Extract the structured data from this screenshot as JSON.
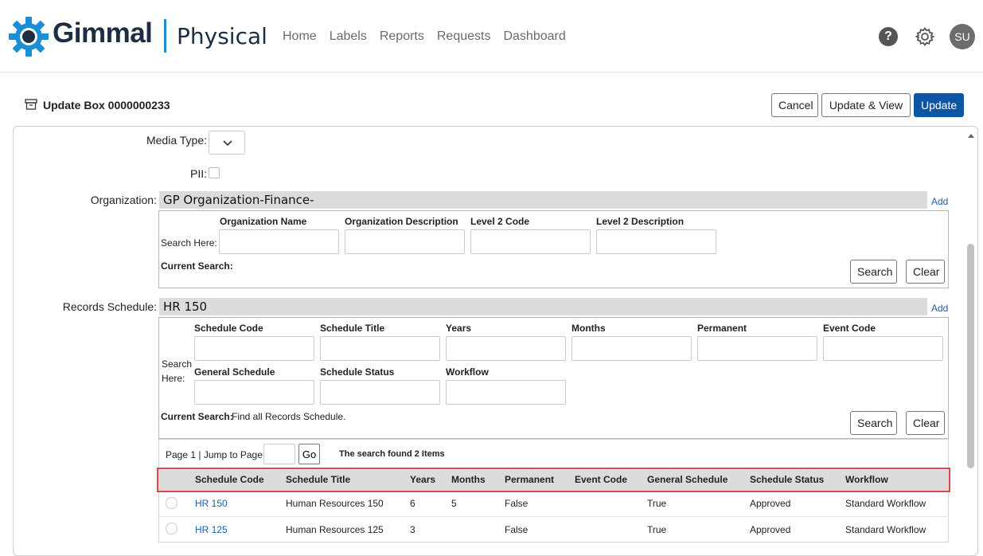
{
  "brand": {
    "name": "Gimmal",
    "product": "Physical"
  },
  "nav": [
    "Home",
    "Labels",
    "Reports",
    "Requests",
    "Dashboard"
  ],
  "user": {
    "initials": "SU",
    "help": "?"
  },
  "page": {
    "title": "Update Box 0000000233"
  },
  "actions": {
    "cancel": "Cancel",
    "update_view": "Update & View",
    "update": "Update"
  },
  "form": {
    "media_type_label": "Media Type:",
    "pii_label": "PII:",
    "organization": {
      "label": "Organization:",
      "value": "GP Organization-Finance-",
      "add": "Add",
      "search_here": "Search Here:",
      "columns": [
        "Organization Name",
        "Organization Description",
        "Level 2 Code",
        "Level 2 Description"
      ],
      "current_search_label": "Current Search:",
      "current_search_value": "",
      "search_btn": "Search",
      "clear_btn": "Clear"
    },
    "records_schedule": {
      "label": "Records Schedule:",
      "value": "HR 150",
      "add": "Add",
      "search_here_1": "Search",
      "search_here_2": "Here:",
      "columns_row1": [
        "Schedule Code",
        "Schedule Title",
        "Years",
        "Months",
        "Permanent",
        "Event Code"
      ],
      "columns_row2": [
        "General Schedule",
        "Schedule Status",
        "Workflow"
      ],
      "current_search_label": "Current Search:",
      "current_search_value": "Find all Records Schedule.",
      "search_btn": "Search",
      "clear_btn": "Clear"
    }
  },
  "results": {
    "page_text": "Page 1 | Jump to Page:",
    "go": "Go",
    "found": "The search found 2 Items",
    "headers": [
      "Schedule Code",
      "Schedule Title",
      "Years",
      "Months",
      "Permanent",
      "Event Code",
      "General Schedule",
      "Schedule Status",
      "Workflow"
    ],
    "rows": [
      [
        "HR 150",
        "Human Resources 150",
        "6",
        "5",
        "False",
        "",
        "True",
        "Approved",
        "Standard Workflow"
      ],
      [
        "HR 125",
        "Human Resources 125",
        "3",
        "",
        "False",
        "",
        "True",
        "Approved",
        "Standard Workflow"
      ]
    ]
  },
  "colors": {
    "brand_navy": "#1d2d44",
    "brand_blue": "#1b8fd6",
    "primary": "#0d56a6",
    "highlight": "#e04848",
    "link": "#1a5fb4"
  }
}
